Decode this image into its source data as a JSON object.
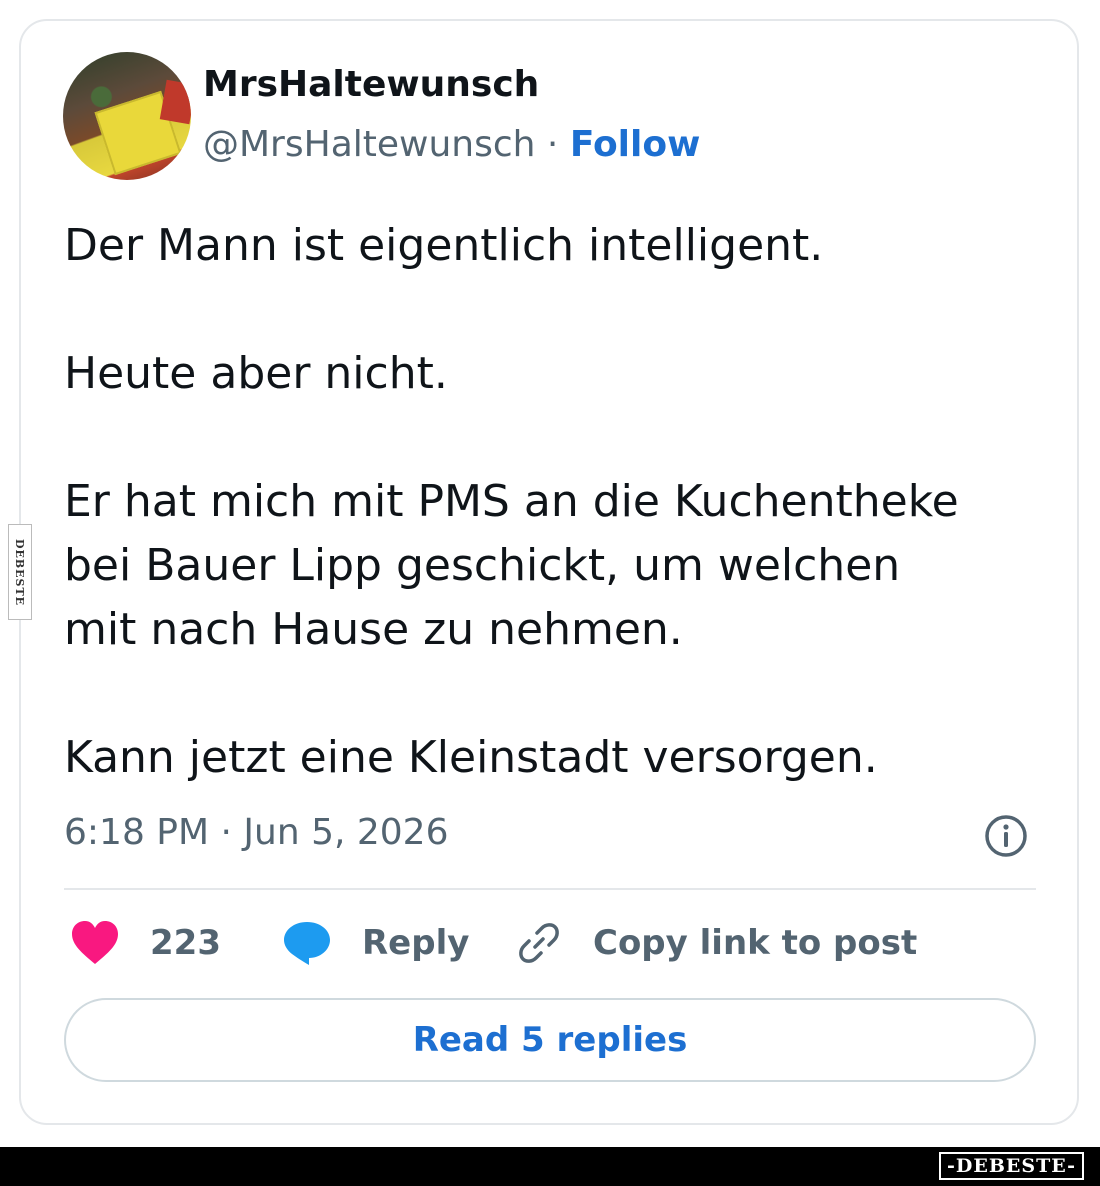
{
  "tweet": {
    "display_name": "MrsHaltewunsch",
    "handle": "@MrsHaltewunsch",
    "separator": " · ",
    "follow_label": "Follow",
    "text": "Der Mann ist eigentlich intelligent.\n\nHeute aber nicht.\n\nEr hat mich mit PMS an die Kuchentheke\nbei Bauer Lipp geschickt, um welchen\nmit nach Hause zu nehmen.\n\nKann jetzt eine Kleinstadt versorgen.",
    "timestamp": "6:18 PM · Jun 5, 2026"
  },
  "actions": {
    "like_count": "223",
    "reply_label": "Reply",
    "copy_label": "Copy link to post"
  },
  "read_replies_label": "Read 5 replies",
  "watermark": {
    "side": "DEBESTE",
    "bottom": "-DEBESTE-"
  },
  "colors": {
    "heart": "#f91880",
    "reply_bubble": "#1d9bf0",
    "link_blue": "#1d6fd1",
    "muted_text": "#536471"
  },
  "icons": [
    "info-icon",
    "heart-icon",
    "reply-bubble-icon",
    "link-icon"
  ]
}
